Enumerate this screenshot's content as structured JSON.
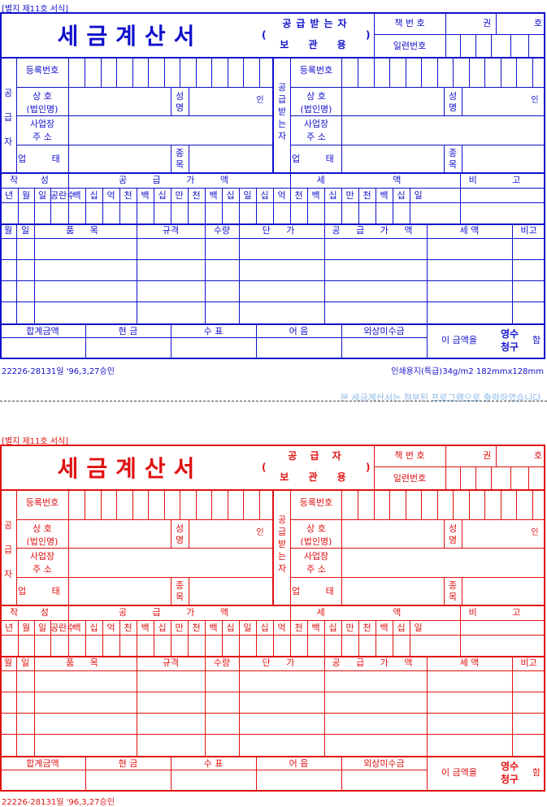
{
  "header": {
    "form_caption": "[별지 제11호 서식]",
    "title": "세금계산서",
    "copy_blue_line1": "공급받는자",
    "copy_red_line1": "공 급 자",
    "copy_line2": "보 관 용",
    "book_number_label": "책 번 호",
    "volume_label": "권",
    "number_label": "호",
    "serial_label": "일련번호"
  },
  "supplier": {
    "side_label": "공급자",
    "reg_label": "등록번호",
    "name_label": "상 호\n(법인명)",
    "rep_label": "성명",
    "seal": "인",
    "addr_label": "사업장\n주 소",
    "type_label": "업 태",
    "item_label": "종목"
  },
  "receiver": {
    "side_label": "공급받는자"
  },
  "amount_header": {
    "date_label": "작 성",
    "supply_label": "공 급 가 액",
    "tax_label": "세 액",
    "note_label": "비 고",
    "cols": [
      "년",
      "월",
      "일",
      "공란수",
      "백",
      "십",
      "억",
      "천",
      "백",
      "십",
      "만",
      "천",
      "백",
      "십",
      "일",
      "십",
      "억",
      "천",
      "백",
      "십",
      "만",
      "천",
      "백",
      "십",
      "일"
    ]
  },
  "items_header": [
    "월",
    "일",
    "품 목",
    "규격",
    "수량",
    "단 가",
    "공 급 가 액",
    "세 액",
    "비고"
  ],
  "totals": {
    "labels": [
      "합계금액",
      "현 금",
      "수 표",
      "어 음",
      "외상미수금"
    ],
    "this_amount": "이 금액을",
    "receipt": "영수",
    "claim": "청구",
    "suffix": "함"
  },
  "footer": {
    "approval": "22226-28131일 '96,3,27승인",
    "paper": "인쇄용지(특급)34g/m2 182mmx128mm"
  },
  "note": "본 세금계산서는 첨부된 프로그램으로 출력하였습니다.",
  "colors": {
    "blue_form": "#1010cc",
    "red_form": "#e01010"
  }
}
